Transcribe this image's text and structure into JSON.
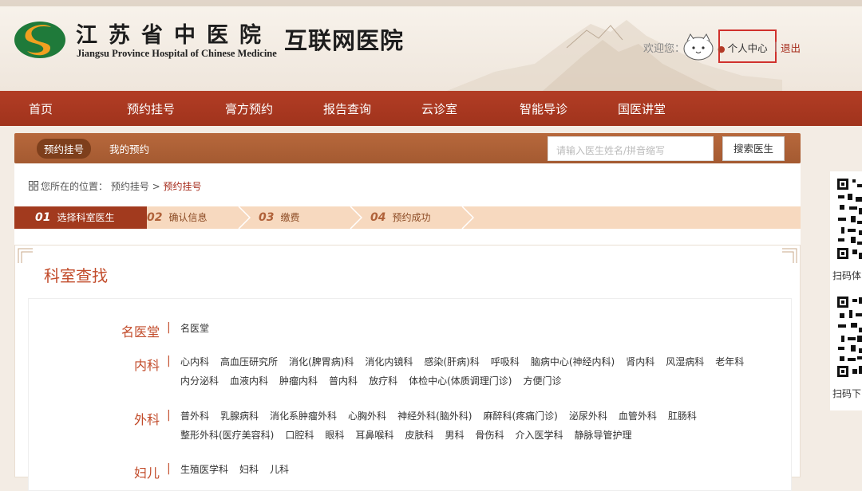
{
  "header": {
    "logo_cn": "江苏省中医院",
    "logo_en": "Jiangsu Province Hospital of Chinese Medicine",
    "subtitle": "互联网医院",
    "welcome": "欢迎您：",
    "user_center": "个人中心",
    "separator": "|",
    "logout": "退出"
  },
  "nav": [
    "首页",
    "预约挂号",
    "膏方预约",
    "报告查询",
    "云诊室",
    "智能导诊",
    "国医讲堂"
  ],
  "subbar": {
    "tabs": [
      "预约挂号",
      "我的预约"
    ],
    "search_placeholder": "请输入医生姓名/拼音缩写",
    "search_button": "搜索医生"
  },
  "breadcrumb": {
    "prefix": "您所在的位置：",
    "path": "预约挂号 >",
    "current": "预约挂号"
  },
  "steps": [
    {
      "num": "01",
      "label": "选择科室医生",
      "active": true
    },
    {
      "num": "02",
      "label": "确认信息",
      "active": false
    },
    {
      "num": "03",
      "label": "缴费",
      "active": false
    },
    {
      "num": "04",
      "label": "预约成功",
      "active": false
    }
  ],
  "panel": {
    "title": "科室查找",
    "categories": [
      {
        "name": "名医堂",
        "items": [
          "名医堂"
        ]
      },
      {
        "name": "内科",
        "items": [
          "心内科",
          "高血压研究所",
          "消化(脾胃病)科",
          "消化内镜科",
          "感染(肝病)科",
          "呼吸科",
          "脑病中心(神经内科)",
          "肾内科",
          "风湿病科",
          "老年科",
          "内分泌科",
          "血液内科",
          "肿瘤内科",
          "普内科",
          "放疗科",
          "体检中心(体质调理门诊)",
          "方便门诊"
        ]
      },
      {
        "name": "外科",
        "items": [
          "普外科",
          "乳腺病科",
          "消化系肿瘤外科",
          "心胸外科",
          "神经外科(脑外科)",
          "麻醉科(疼痛门诊)",
          "泌尿外科",
          "血管外科",
          "肛肠科",
          "整形外科(医疗美容科)",
          "口腔科",
          "眼科",
          "耳鼻喉科",
          "皮肤科",
          "男科",
          "骨伤科",
          "介入医学科",
          "静脉导管护理"
        ]
      },
      {
        "name": "妇儿",
        "items": [
          "生殖医学科",
          "妇科",
          "儿科"
        ]
      }
    ]
  },
  "qr": {
    "label1": "扫码体",
    "label2": "扫码下"
  },
  "colors": {
    "brand": "#a23a1e",
    "accent": "#c24b2a"
  }
}
